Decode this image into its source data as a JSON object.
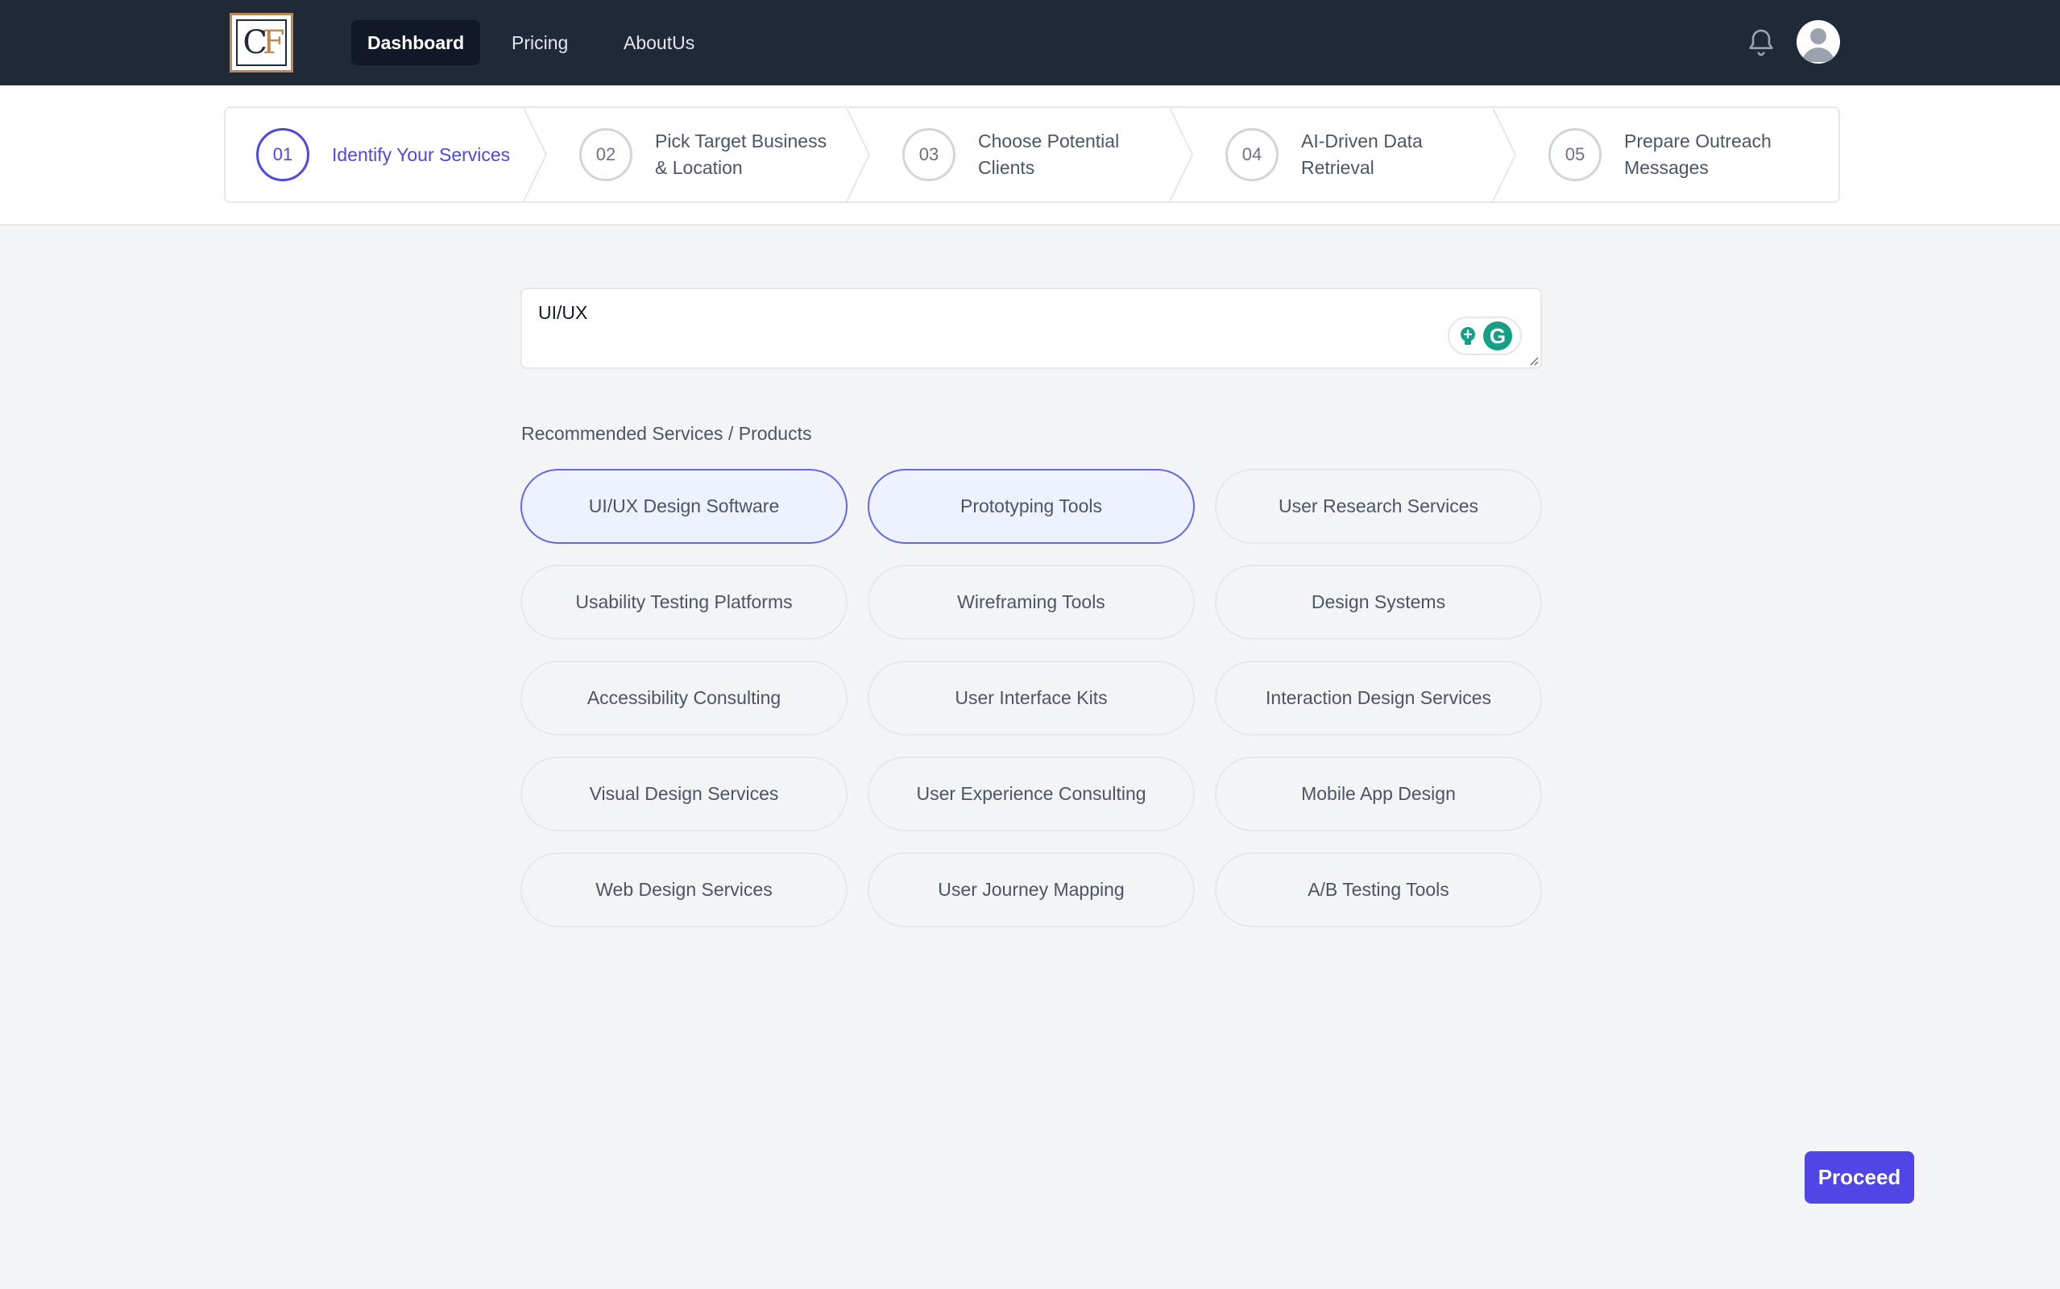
{
  "nav": {
    "logo_text_c": "C",
    "logo_text_f": "F",
    "links": [
      {
        "label": "Dashboard",
        "active": true
      },
      {
        "label": "Pricing",
        "active": false
      },
      {
        "label": "AboutUs",
        "active": false
      }
    ],
    "notification_icon": "bell-icon",
    "avatar_icon": "user-avatar-icon"
  },
  "steps": [
    {
      "num": "01",
      "label": "Identify Your Services",
      "active": true
    },
    {
      "num": "02",
      "label": "Pick Target Business & Location",
      "active": false
    },
    {
      "num": "03",
      "label": "Choose Potential Clients",
      "active": false
    },
    {
      "num": "04",
      "label": "AI-Driven Data Retrieval",
      "active": false
    },
    {
      "num": "05",
      "label": "Prepare Outreach Messages",
      "active": false
    }
  ],
  "service_input": {
    "value": "UI/UX"
  },
  "recommended": {
    "heading": "Recommended Services / Products",
    "items": [
      {
        "label": "UI/UX Design Software",
        "selected": true
      },
      {
        "label": "Prototyping Tools",
        "selected": true
      },
      {
        "label": "User Research Services",
        "selected": false
      },
      {
        "label": "Usability Testing Platforms",
        "selected": false
      },
      {
        "label": "Wireframing Tools",
        "selected": false
      },
      {
        "label": "Design Systems",
        "selected": false
      },
      {
        "label": "Accessibility Consulting",
        "selected": false
      },
      {
        "label": "User Interface Kits",
        "selected": false
      },
      {
        "label": "Interaction Design Services",
        "selected": false
      },
      {
        "label": "Visual Design Services",
        "selected": false
      },
      {
        "label": "User Experience Consulting",
        "selected": false
      },
      {
        "label": "Mobile App Design",
        "selected": false
      },
      {
        "label": "Web Design Services",
        "selected": false
      },
      {
        "label": "User Journey Mapping",
        "selected": false
      },
      {
        "label": "A/B Testing Tools",
        "selected": false
      }
    ]
  },
  "actions": {
    "proceed_label": "Proceed"
  },
  "colors": {
    "nav_bg": "#1f2937",
    "accent": "#4f46e5",
    "selected_chip_bg": "#eef2ff",
    "logo_gold": "#c2874d"
  }
}
